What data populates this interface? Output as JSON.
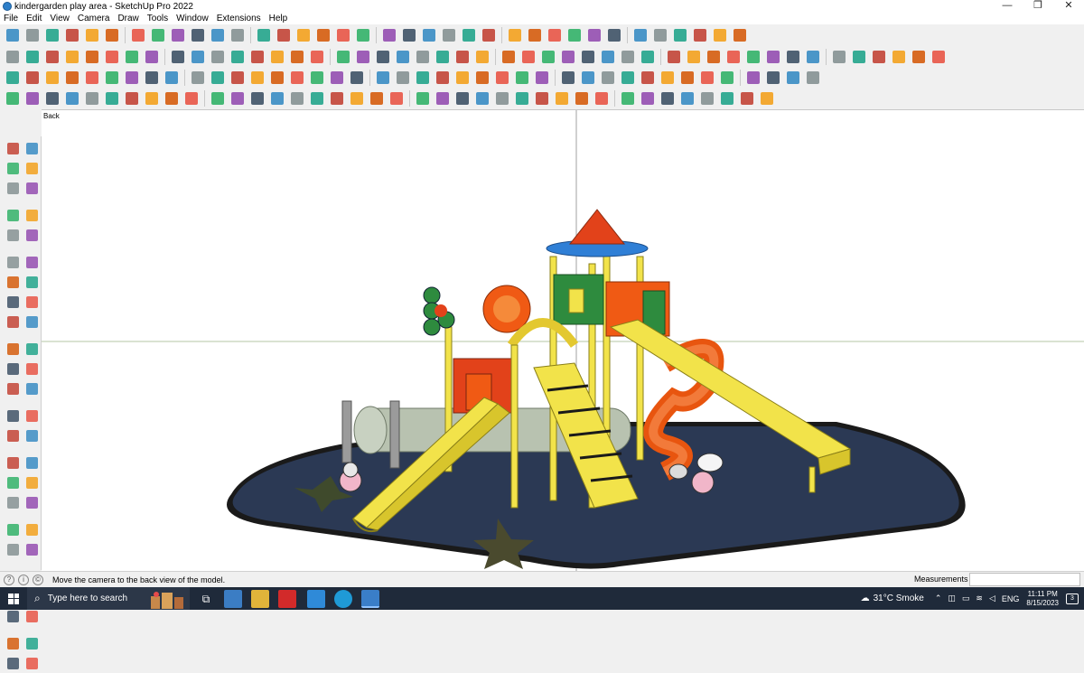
{
  "window": {
    "title": "kindergarden play area - SketchUp Pro 2022",
    "minimize": "—",
    "restore": "❐",
    "close": "✕"
  },
  "menu": [
    "File",
    "Edit",
    "View",
    "Camera",
    "Draw",
    "Tools",
    "Window",
    "Extensions",
    "Help"
  ],
  "viewport": {
    "scene_label": "Back"
  },
  "statusbar": {
    "hint": "Move the camera to the back view of the model.",
    "measurements_label": "Measurements",
    "measurements_value": ""
  },
  "taskbar": {
    "search_placeholder": "Type here to search",
    "weather": "31°C  Smoke",
    "language": "ENG",
    "time": "11:11 PM",
    "date": "8/15/2023"
  },
  "colors": {
    "titlebar_bg": "#ffffff",
    "chrome_bg": "#f0f0f0",
    "viewport_bg": "#ffffff",
    "taskbar_bg": "#1f2a3a",
    "mat": "#2b3954",
    "mat_edge": "#1a1a1a",
    "slide_yellow": "#f2e34a",
    "slide_orange": "#f05a14",
    "roof_red": "#e2421a",
    "roof_blue": "#2f7fd6",
    "wall_green": "#2e8b3e",
    "tunnel_grey": "#b8c2b0"
  }
}
